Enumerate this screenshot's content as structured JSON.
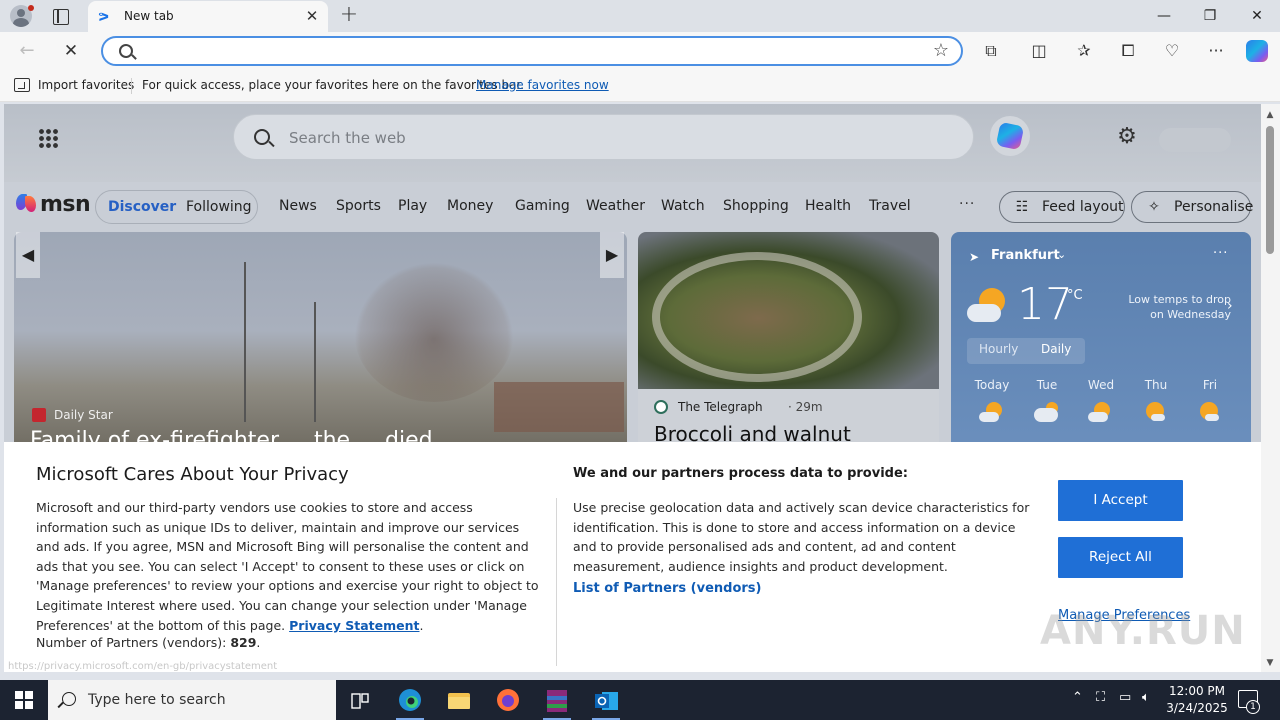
{
  "browser": {
    "tab": {
      "title": "New tab"
    },
    "address": {
      "value": "",
      "placeholder": ""
    },
    "favorites_bar": {
      "import_label": "Import favorites",
      "text": "For quick access, place your favorites here on the favorites bar.",
      "link": "Manage favorites now"
    },
    "window_controls": {
      "minimize": "—",
      "restore": "❐",
      "close": "✕"
    },
    "icons": [
      "profile-icon",
      "tab-actions-icon",
      "back-icon",
      "stop-icon",
      "search-icon",
      "favorite-star-icon",
      "extensions-icon",
      "split-screen-icon",
      "favorites-icon",
      "collections-icon",
      "browser-essentials-icon",
      "more-icon",
      "copilot-icon"
    ]
  },
  "msn": {
    "search_placeholder": "Search the web",
    "logo_text": "msn",
    "segments": [
      "Discover",
      "Following"
    ],
    "nav": [
      "News",
      "Sports",
      "Play",
      "Money",
      "Gaming",
      "Weather",
      "Watch",
      "Shopping",
      "Health",
      "Travel"
    ],
    "more": "···",
    "feed_layout": "Feed layout",
    "personalise": "Personalise",
    "hero": {
      "source": "Daily Star",
      "headline": "Family of ex-firefighter ... the ... died"
    },
    "card": {
      "source": "The Telegraph",
      "time": "· 29m",
      "title": "Broccoli and walnut"
    },
    "weather": {
      "location": "Frankfurt",
      "temperature": "17",
      "unit": "°C",
      "note": "Low temps to drop on Wednesday",
      "tabs": [
        "Hourly",
        "Daily"
      ],
      "active_tab": "Daily",
      "days": [
        "Today",
        "Tue",
        "Wed",
        "Thu",
        "Fri"
      ]
    }
  },
  "privacy": {
    "title": "Microsoft Cares About Your Privacy",
    "body": "Microsoft and our third-party vendors use cookies to store and access information such as unique IDs to deliver, maintain and improve our services and ads. If you agree, MSN and Microsoft Bing will personalise the content and ads that you see. You can select 'I Accept' to consent to these uses or click on 'Manage preferences' to review your options and exercise your right to object to Legitimate Interest where used.  You can change your selection under 'Manage Preferences' at the bottom of this page.",
    "privacy_link": "Privacy Statement",
    "partners_label": "Number of Partners (vendors):",
    "partners_count": "829",
    "subtitle": "We and our partners process data to provide:",
    "purpose": "Use precise geolocation data and actively scan device characteristics for identification. This is done to store and access information on a device and to provide personalised ads and content, ad and content measurement, audience insights and product development.",
    "list_partners": "List of Partners (vendors)",
    "accept": "I Accept",
    "reject": "Reject All",
    "manage": "Manage Preferences",
    "status_url": "https://privacy.microsoft.com/en-gb/privacystatement"
  },
  "watermark": "ANY.RUN",
  "taskbar": {
    "search_placeholder": "Type here to search",
    "time": "12:00 PM",
    "date": "3/24/2025",
    "notification_count": "1"
  }
}
